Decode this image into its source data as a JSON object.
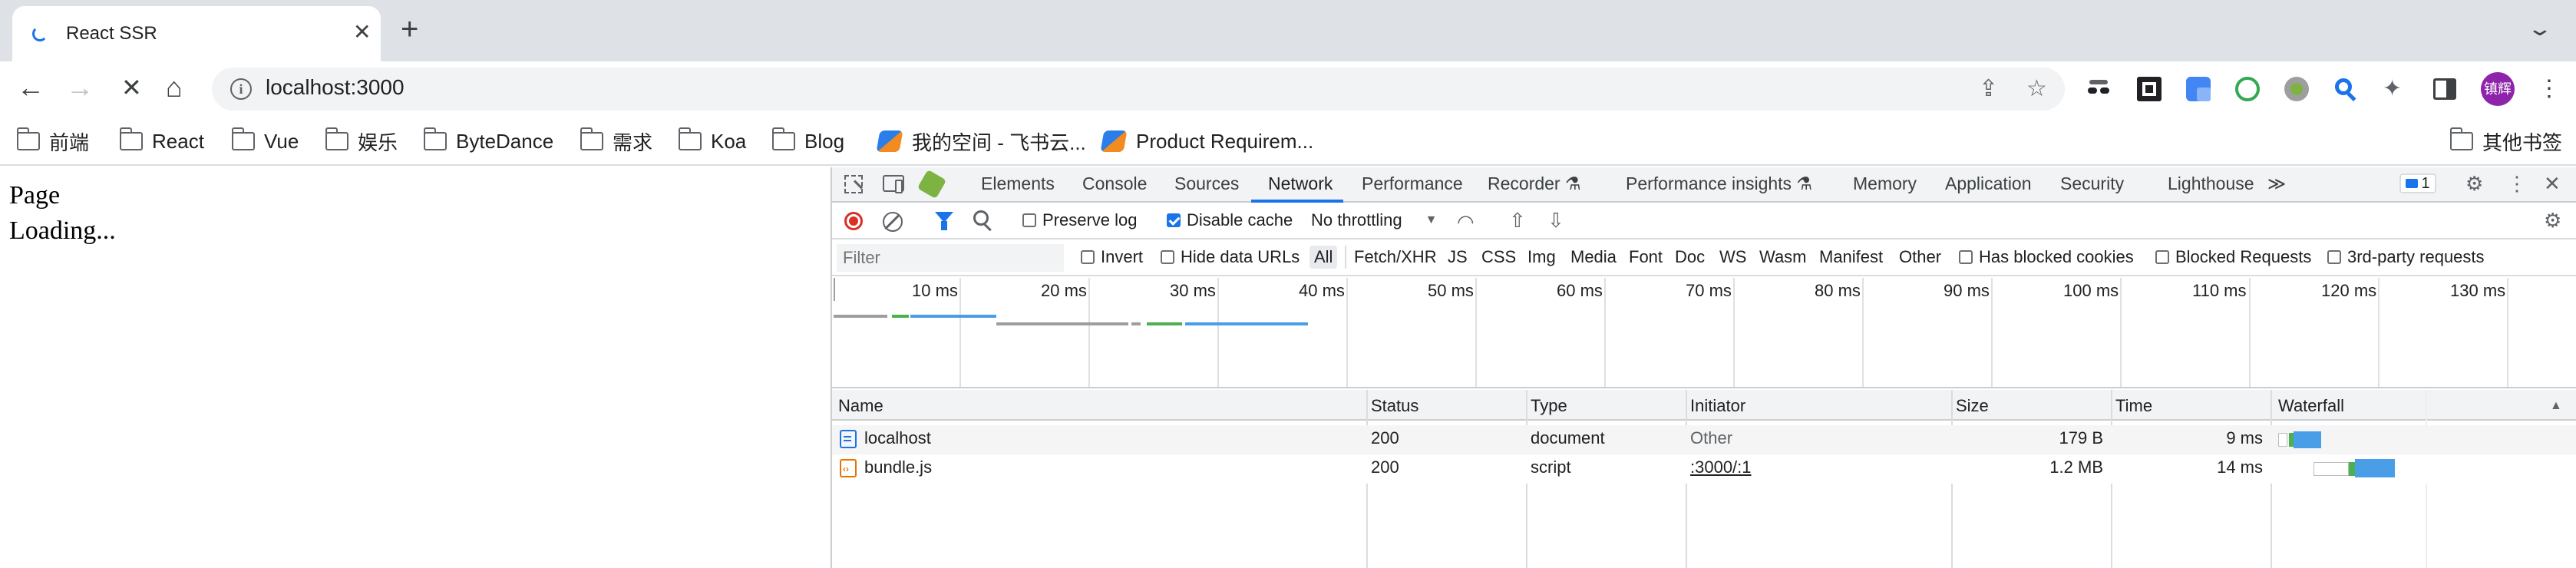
{
  "browser": {
    "tab": {
      "title": "React SSR",
      "close": "✕"
    },
    "new_tab": "+",
    "tab_search": "⌄",
    "toolbar": {
      "back": "←",
      "forward": "→",
      "reload": "✕",
      "home": "⌂",
      "info": "i",
      "url": "localhost:3000",
      "share_icon": "⇪",
      "star_icon": "☆",
      "puzzle_icon": "✦",
      "sidepanel_icon": "▮",
      "menu_icon": "⋮",
      "avatar": "镇辉"
    },
    "bookmarks": [
      {
        "label": "前端",
        "type": "folder"
      },
      {
        "label": "React",
        "type": "folder"
      },
      {
        "label": "Vue",
        "type": "folder"
      },
      {
        "label": "娱乐",
        "type": "folder"
      },
      {
        "label": "ByteDance",
        "type": "folder"
      },
      {
        "label": "需求",
        "type": "folder"
      },
      {
        "label": "Koa",
        "type": "folder"
      },
      {
        "label": "Blog",
        "type": "folder"
      },
      {
        "label": "我的空间 - 飞书云...",
        "type": "link"
      },
      {
        "label": "Product Requirem...",
        "type": "link"
      }
    ],
    "other_bookmarks": "其他书签"
  },
  "page": {
    "line1": "Page",
    "line2": "Loading..."
  },
  "devtools": {
    "tabs": [
      "Elements",
      "Console",
      "Sources",
      "Network",
      "Performance",
      "Recorder ⚗",
      "Performance insights ⚗",
      "Memory",
      "Application",
      "Security",
      "Lighthouse"
    ],
    "active_tab": "Network",
    "more_tabs": "≫",
    "issues_count": "1",
    "toolbar": {
      "preserve_log": "Preserve log",
      "preserve_log_checked": false,
      "disable_cache": "Disable cache",
      "disable_cache_checked": true,
      "throttling": "No throttling"
    },
    "filter": {
      "placeholder": "Filter",
      "invert": "Invert",
      "hide_data_urls": "Hide data URLs",
      "types": [
        "All",
        "Fetch/XHR",
        "JS",
        "CSS",
        "Img",
        "Media",
        "Font",
        "Doc",
        "WS",
        "Wasm",
        "Manifest",
        "Other"
      ],
      "active_type": "All",
      "has_blocked_cookies": "Has blocked cookies",
      "blocked_requests": "Blocked Requests",
      "third_party": "3rd-party requests"
    },
    "overview_ticks": [
      "10 ms",
      "20 ms",
      "30 ms",
      "40 ms",
      "50 ms",
      "60 ms",
      "70 ms",
      "80 ms",
      "90 ms",
      "100 ms",
      "110 ms",
      "120 ms",
      "130 ms"
    ],
    "columns": [
      "Name",
      "Status",
      "Type",
      "Initiator",
      "Size",
      "Time",
      "Waterfall"
    ],
    "sort_indicator": "▲",
    "requests": [
      {
        "name": "localhost",
        "status": "200",
        "type": "document",
        "initiator": "Other",
        "size": "179 B",
        "time": "9 ms",
        "icon": "document-icon",
        "icon_color": "#1a73e8"
      },
      {
        "name": "bundle.js",
        "status": "200",
        "type": "script",
        "initiator": ":3000/:1",
        "size": "1.2 MB",
        "time": "14 ms",
        "icon": "script-icon",
        "icon_color": "#e37400"
      }
    ],
    "colors": {
      "accent": "#1a73e8",
      "record": "#d93025",
      "waiting": "#4caf50",
      "download": "#4a9ee8",
      "queue": "#9e9e9e"
    }
  }
}
